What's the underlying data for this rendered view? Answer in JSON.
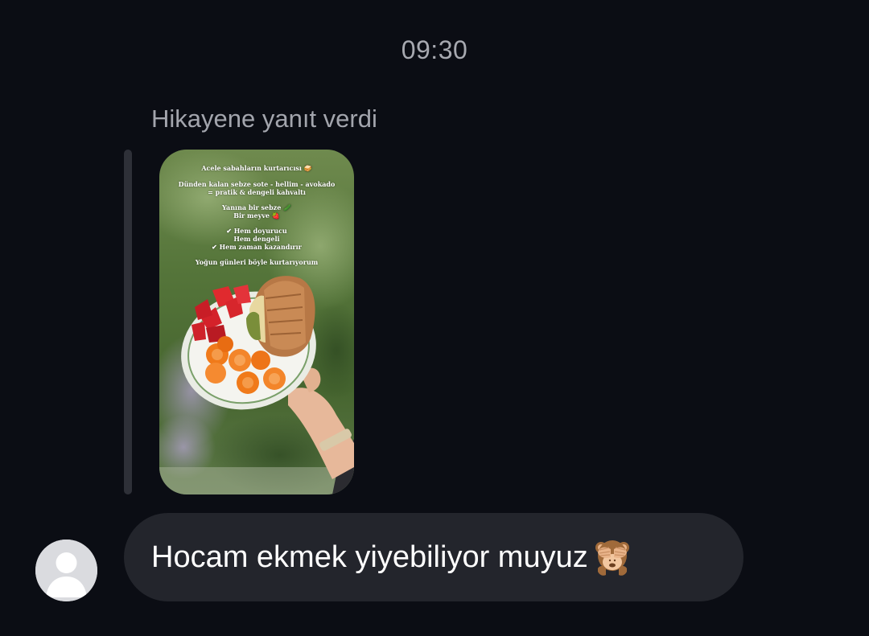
{
  "chat": {
    "timestamp": "09:30",
    "reply_label": "Hikayene yanıt verdi"
  },
  "story": {
    "lines": [
      "Acele sabahların kurtarıcısı 🥪",
      "Dünden kalan sebze sote - hellim - avokado",
      "= pratik & dengeli kahvaltı",
      "Yanına bir sebze 🥒",
      "Bir meyve 🍓",
      "✔ Hem doyurucu",
      "Hem dengeli",
      "✔ Hem zaman kazandırır",
      "Yoğun günleri böyle kurtarıyorum"
    ]
  },
  "message": {
    "text": "Hocam ekmek yiyebiliyor muyuz",
    "emoji": "see-no-evil-monkey"
  },
  "colors": {
    "background": "#0b0d14",
    "bubble": "#23252c",
    "secondary_text": "#a3a5ad",
    "quote_bar": "#2e3038"
  }
}
